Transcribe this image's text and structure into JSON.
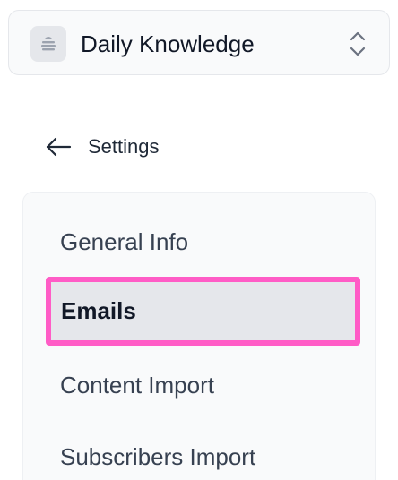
{
  "workspace": {
    "name": "Daily Knowledge",
    "logo_icon": "newsletter-logo-icon",
    "switch_icon": "chevron-up-down-icon"
  },
  "back": {
    "label": "Settings",
    "icon": "arrow-left-icon"
  },
  "settings_nav": {
    "items": [
      {
        "label": "General Info",
        "active": false
      },
      {
        "label": "Emails",
        "active": true
      },
      {
        "label": "Content Import",
        "active": false
      },
      {
        "label": "Subscribers Import",
        "active": false
      }
    ]
  },
  "colors": {
    "highlight": "#ff5cc6",
    "active_bg": "#e5e7eb",
    "panel_bg": "#f9fafb"
  }
}
